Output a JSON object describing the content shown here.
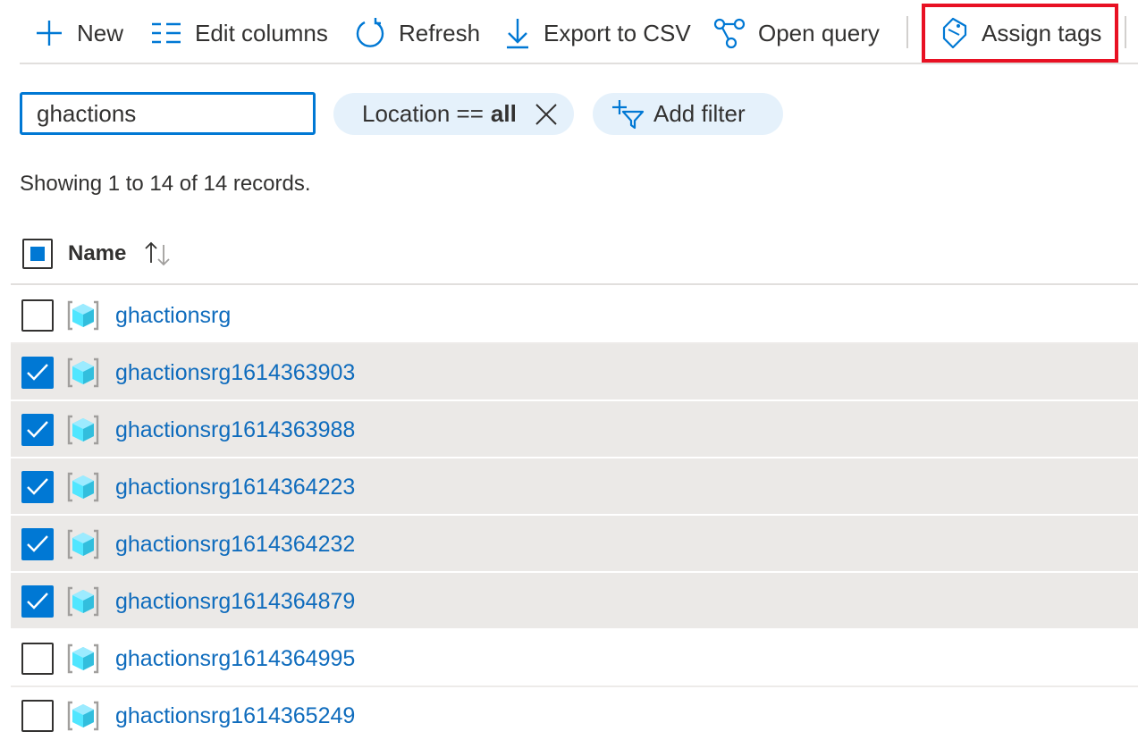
{
  "toolbar": {
    "new": "New",
    "edit_columns": "Edit columns",
    "refresh": "Refresh",
    "export_csv": "Export to CSV",
    "open_query": "Open query",
    "assign_tags": "Assign tags"
  },
  "search": {
    "value": "ghactions"
  },
  "filters": {
    "location_label": "Location ==",
    "location_value": "all",
    "add_filter": "Add filter"
  },
  "status_text": "Showing 1 to 14 of 14 records.",
  "table": {
    "column_name": "Name",
    "rows": [
      {
        "name": "ghactionsrg",
        "selected": false
      },
      {
        "name": "ghactionsrg1614363903",
        "selected": true
      },
      {
        "name": "ghactionsrg1614363988",
        "selected": true
      },
      {
        "name": "ghactionsrg1614364223",
        "selected": true
      },
      {
        "name": "ghactionsrg1614364232",
        "selected": true
      },
      {
        "name": "ghactionsrg1614364879",
        "selected": true
      },
      {
        "name": "ghactionsrg1614364995",
        "selected": false
      },
      {
        "name": "ghactionsrg1614365249",
        "selected": false
      }
    ]
  },
  "colors": {
    "accent": "#0078d4",
    "link": "#0f6cbd",
    "highlight_box": "#e81123",
    "selected_row": "#ebe9e7",
    "filter_pill": "#e5f1fb"
  }
}
